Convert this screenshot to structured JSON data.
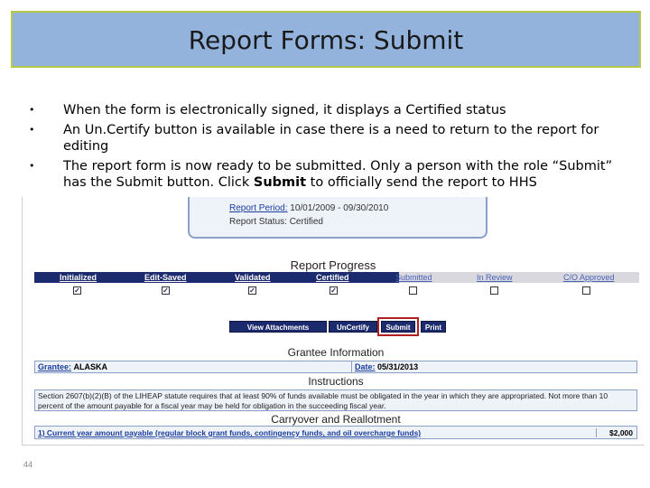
{
  "slide": {
    "title": "Report Forms: Submit",
    "page_number": "44",
    "colors": {
      "title_bg": "#93b3dd",
      "title_border": "#b7c94a",
      "nav_blue": "#1c2a6e",
      "highlight_red": "#b02020"
    }
  },
  "bullets": [
    {
      "text": "When the form is electronically signed, it displays a Certified status"
    },
    {
      "text": "An Un.Certify button is available in case there is a need to return to the report for editing"
    },
    {
      "before": "The report form is now ready to be submitted. Only a person with the role “Submit” has the Submit button. Click ",
      "bold": "Submit",
      "after": " to officially send the report to HHS"
    }
  ],
  "report": {
    "period_label": "Report Period:",
    "period_value": "10/01/2009 - 09/30/2010",
    "status_label": "Report Status:",
    "status_value": "Certified"
  },
  "progress": {
    "title": "Report Progress",
    "stages": [
      {
        "label": "Initialized",
        "checked": true
      },
      {
        "label": "Edit-Saved",
        "checked": true
      },
      {
        "label": "Validated",
        "checked": true
      },
      {
        "label": "Certified",
        "checked": true
      },
      {
        "label": "Submitted",
        "checked": false
      },
      {
        "label": "In Review",
        "checked": false
      },
      {
        "label": "C/O Approved",
        "checked": false
      }
    ],
    "check_glyph": "✓"
  },
  "actions": {
    "view_attachments": "View Attachments",
    "uncertify": "UnCertify",
    "submit": "Submit",
    "print": "Print"
  },
  "grantee": {
    "heading": "Grantee Information",
    "name_label": "Grantee:",
    "name_value": "ALASKA",
    "date_label": "Date:",
    "date_value": "05/31/2013"
  },
  "instructions": {
    "heading": "Instructions",
    "text": "Section 2607(b)(2)(B) of the LIHEAP statute requires that at least 90% of funds available must be obligated in the year in which they are appropriated. Not more than 10 percent of the amount payable for a fiscal year may be held for obligation in the succeeding fiscal year."
  },
  "carryover": {
    "heading": "Carryover and Reallotment",
    "q1_label": "1) Current year amount payable (regular block grant funds, contingency funds, and oil overcharge funds)",
    "q1_value": "$2,000"
  }
}
